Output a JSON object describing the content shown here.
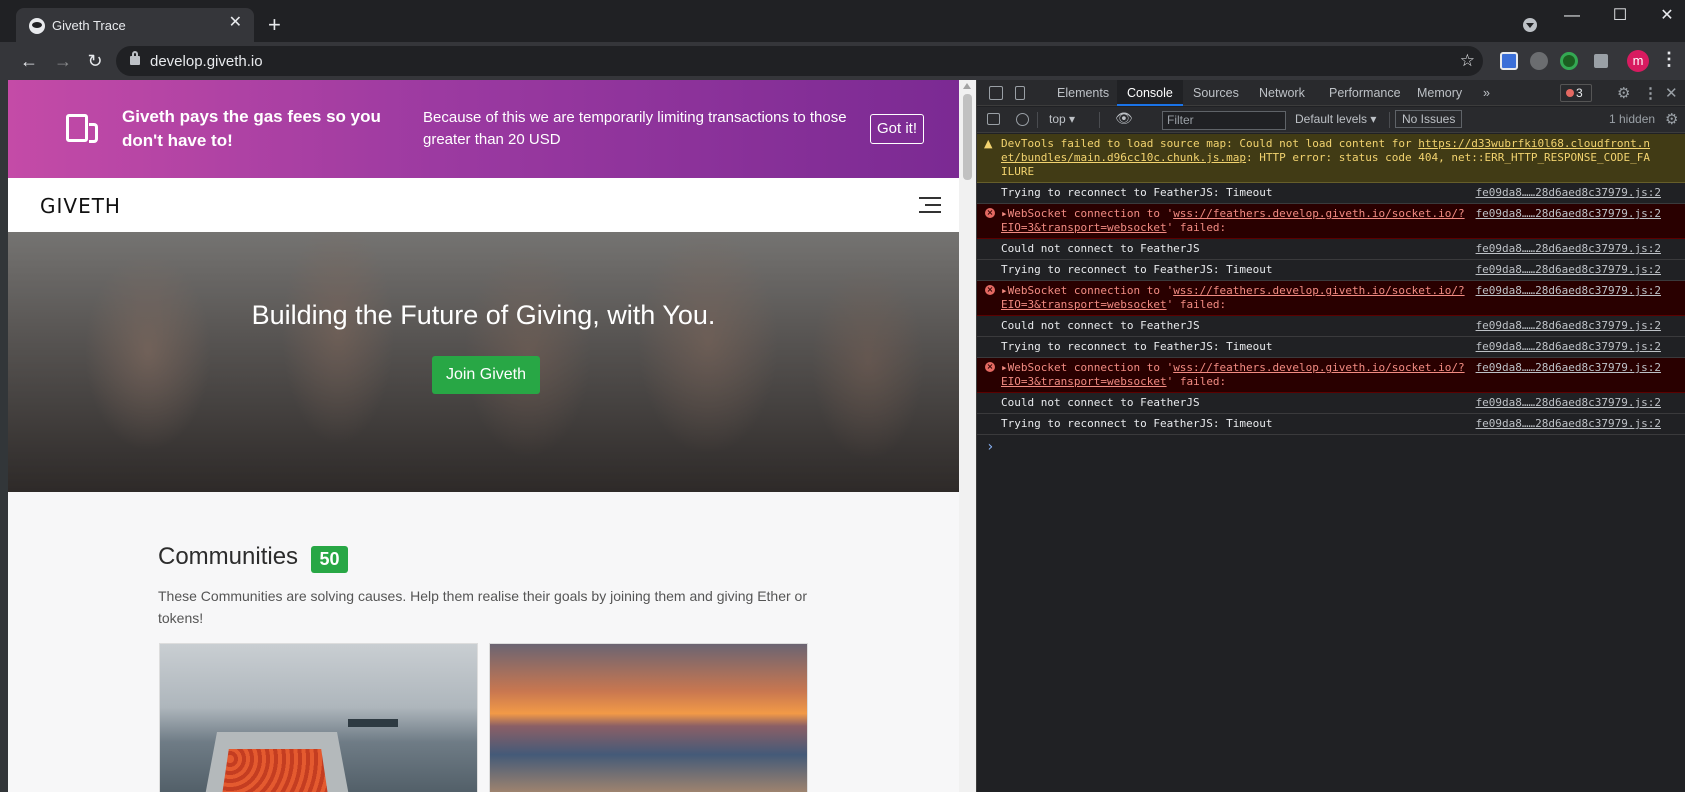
{
  "browser": {
    "tab_title": "Giveth Trace",
    "tab_close": "✕",
    "new_tab": "+",
    "url": "develop.giveth.io",
    "back": "←",
    "forward": "→",
    "reload": "↻",
    "star": "☆",
    "avatar_letter": "m",
    "window_controls": {
      "minimize": "—",
      "maximize": "☐",
      "close": "✕"
    }
  },
  "page": {
    "banner": {
      "title": "Giveth pays the gas fees so you don't have to!",
      "text": "Because of this we are temporarily limiting transactions to those greater than 20 USD",
      "button": "Got it!"
    },
    "header": {
      "logo": "GIVETH"
    },
    "hero": {
      "title": "Building the Future of Giving, with You.",
      "button": "Join Giveth"
    },
    "communities": {
      "title": "Communities",
      "count": "50",
      "description": "These Communities are solving causes. Help them realise their goals by joining them and giving Ether or tokens!"
    }
  },
  "devtools": {
    "tabs": [
      "Elements",
      "Console",
      "Sources",
      "Network",
      "Performance",
      "Memory"
    ],
    "more_tabs": "»",
    "error_count": "3",
    "toolbar": {
      "context": "top ▾",
      "filter_placeholder": "Filter",
      "levels": "Default levels ▾",
      "issues": "No Issues",
      "hidden": "1 hidden"
    },
    "logs": [
      {
        "type": "warn",
        "msg_prefix": "DevTools failed to load source map: Could not load content for ",
        "link": "https://d33wubrfki0l68.cloudfront.net/bundles/main.d96cc10c.chunk.js.map",
        "msg_suffix": ": HTTP error: status code 404, net::ERR_HTTP_RESPONSE_CODE_FAILURE",
        "src": ""
      },
      {
        "type": "info",
        "msg": "Trying to reconnect to FeatherJS: Timeout",
        "src": "fe09da8……28d6aed8c37979.js:2"
      },
      {
        "type": "error",
        "msg_prefix": "▸WebSocket connection to '",
        "link": "wss://feathers.develop.giveth.io/socket.io/?EIO=3&transport=websocket",
        "msg_suffix": "' failed:",
        "src": "fe09da8……28d6aed8c37979.js:2"
      },
      {
        "type": "info",
        "msg": "Could not connect to FeatherJS",
        "src": "fe09da8……28d6aed8c37979.js:2"
      },
      {
        "type": "info",
        "msg": "Trying to reconnect to FeatherJS: Timeout",
        "src": "fe09da8……28d6aed8c37979.js:2"
      },
      {
        "type": "error",
        "msg_prefix": "▸WebSocket connection to '",
        "link": "wss://feathers.develop.giveth.io/socket.io/?EIO=3&transport=websocket",
        "msg_suffix": "' failed:",
        "src": "fe09da8……28d6aed8c37979.js:2"
      },
      {
        "type": "info",
        "msg": "Could not connect to FeatherJS",
        "src": "fe09da8……28d6aed8c37979.js:2"
      },
      {
        "type": "info",
        "msg": "Trying to reconnect to FeatherJS: Timeout",
        "src": "fe09da8……28d6aed8c37979.js:2"
      },
      {
        "type": "error",
        "msg_prefix": "▸WebSocket connection to '",
        "link": "wss://feathers.develop.giveth.io/socket.io/?EIO=3&transport=websocket",
        "msg_suffix": "' failed:",
        "src": "fe09da8……28d6aed8c37979.js:2"
      },
      {
        "type": "info",
        "msg": "Could not connect to FeatherJS",
        "src": "fe09da8……28d6aed8c37979.js:2"
      },
      {
        "type": "info",
        "msg": "Trying to reconnect to FeatherJS: Timeout",
        "src": "fe09da8……28d6aed8c37979.js:2"
      }
    ],
    "prompt": "›"
  },
  "colors": {
    "accent_green": "#28a745",
    "banner_gradient_start": "#c44ba7",
    "banner_gradient_end": "#7b2a93",
    "devtools_bg": "#202124",
    "error_bg": "#290000",
    "warn_bg": "#413b15"
  },
  "icons": [
    "giveth-favicon-icon",
    "lock-icon",
    "star-icon",
    "extension-icons",
    "gas-pump-icon",
    "menu-icon",
    "inspect-icon",
    "device-icon",
    "gear-icon",
    "error-icon",
    "warning-icon"
  ]
}
